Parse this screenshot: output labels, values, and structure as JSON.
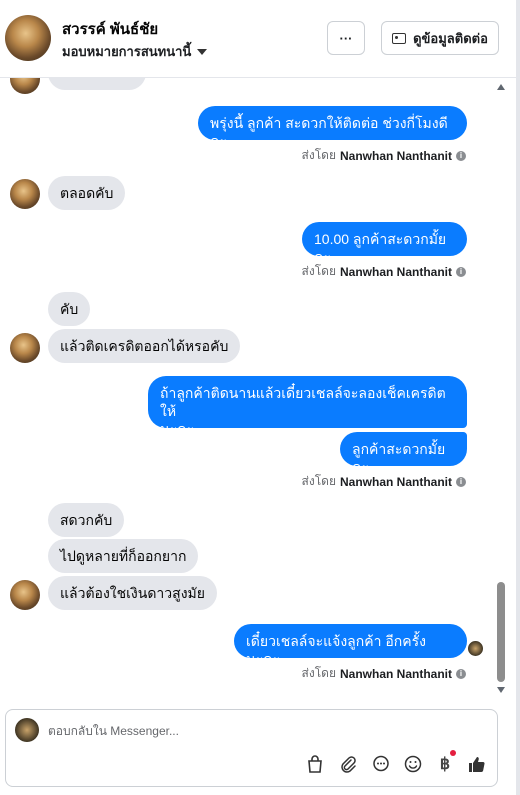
{
  "header": {
    "name": "สวรรค์ พันธ์ชัย",
    "assign_label": "มอบหมายการสนทนานี้",
    "more_label": "···",
    "contact_label": "ดูข้อมูลติดต่อ"
  },
  "messages": {
    "m1": "พรุ่งนี้ ลูกค้า สะดวกให้ติดต่อ ช่วงกี่โมงดีคะ",
    "m2": "ตลอดคับ",
    "m3": "10.00 ลูกค้าสะดวกมั้ยคะ",
    "m4": "คับ",
    "m5": "แล้วติดเครดิตออกได้หรอคับ",
    "m6_line1": "ถ้าลูกค้าติดนานแล้วเดี๋ยวเชลล์จะลองเช็คเครดิตให้",
    "m6_line2": "นะคะ",
    "m7": "ลูกค้าสะดวกมั้ยคะ",
    "m8": "สดวกคับ",
    "m9": "ไปดูหลายที่ก็ออกยาก",
    "m10": "แล้วต้องใชเงินดาวสูงมัย",
    "m11": "เดี๋ยวเชลล์จะแจ้งลูกค้า อีกครั้ง นะคะ"
  },
  "sender": {
    "prefix": "ส่งโดย",
    "name": "Nanwhan Nanthanit",
    "info": "i"
  },
  "composer": {
    "placeholder": "ตอบกลับใน Messenger..."
  },
  "icons": {
    "bag": "shopping-bag-icon",
    "attach": "paperclip-icon",
    "chat": "speech-bubble-icon",
    "emoji": "smiley-icon",
    "baht": "฿",
    "like": "thumbs-up-icon"
  },
  "colors": {
    "outgoing": "#0a7cff",
    "incoming": "#e4e6eb",
    "notification": "#e41e3f"
  }
}
